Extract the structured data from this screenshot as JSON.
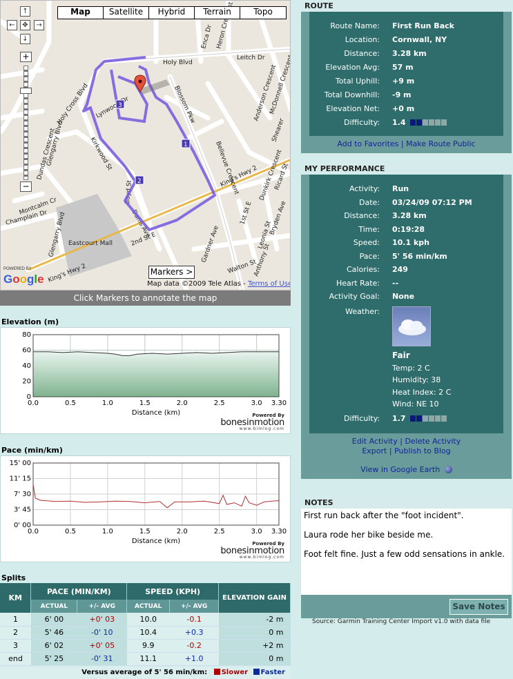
{
  "map": {
    "types": [
      "Map",
      "Satellite",
      "Hybrid",
      "Terrain",
      "Topo"
    ],
    "active_type": "Map",
    "markers_label": "Markers >",
    "logo_powered": "POWERED BY",
    "logo_text": "Google",
    "copyright": "Map data ©2009 Tele Atlas -",
    "terms": "Terms of Use",
    "caption": "Click Markers to annotate the map",
    "streets": [
      "Leitch Dr",
      "Holy Blvd",
      "Enca Dr",
      "Heron Crescent",
      "McDonnell Crescent",
      "Anderson Crescent",
      "Blossom Pkw",
      "Holy Cross Blvd",
      "Lynwood Dr",
      "Kirkwood St",
      "Glengarry Blvd",
      "Dundas Crescent",
      "Bellevue Crescent",
      "King's Hwy 2",
      "Dunkirk Crescent",
      "Ricard St",
      "Bryden Ave",
      "1st St E",
      "Leonia St",
      "Boyd St",
      "Danis Ave",
      "2nd St E",
      "Montcalm Cr",
      "Champlain Dr",
      "Gardner Ave",
      "Walton St",
      "Anthony St",
      "King's Hwy 2",
      "Eastcourt Mall",
      "Glengarry Blvd",
      "Shearer"
    ],
    "route_markers": [
      "1",
      "2",
      "3"
    ]
  },
  "elevation_chart": {
    "title": "Elevation (m)",
    "powered": "Powered By",
    "brand": "bonesinmotion",
    "brand_url": "www.bimlog.com"
  },
  "pace_chart": {
    "title": "Pace (min/km)",
    "powered": "Powered By",
    "brand": "bonesinmotion",
    "brand_url": "www.bimlog.com"
  },
  "chart_data": [
    {
      "type": "area",
      "title": "Elevation (m)",
      "xlabel": "Distance (km)",
      "ylabel": "",
      "xlim": [
        0,
        3.3
      ],
      "ylim": [
        0,
        80
      ],
      "x_ticks": [
        "0.0",
        "0.5",
        "1.0",
        "1.5",
        "2.0",
        "2.5",
        "3.0",
        "3.30"
      ],
      "y_ticks": [
        "0",
        "20",
        "40",
        "60",
        "80"
      ],
      "grid": true,
      "x": [
        0,
        0.2,
        0.4,
        0.6,
        0.8,
        1.0,
        1.1,
        1.2,
        1.3,
        1.4,
        1.6,
        1.8,
        2.0,
        2.2,
        2.4,
        2.6,
        2.8,
        3.0,
        3.2,
        3.3
      ],
      "values": [
        58,
        58,
        57,
        58,
        57,
        56,
        55,
        53,
        53,
        55,
        56,
        55,
        56,
        57,
        56,
        57,
        58,
        58,
        58,
        58
      ]
    },
    {
      "type": "line",
      "title": "Pace (min/km)",
      "xlabel": "Distance (km)",
      "ylabel": "",
      "xlim": [
        0,
        3.3
      ],
      "ylim": [
        0,
        15
      ],
      "x_ticks": [
        "0.0",
        "0.5",
        "1.0",
        "1.5",
        "2.0",
        "2.5",
        "3.0",
        "3.30"
      ],
      "y_ticks": [
        "0' 00",
        "3' 45",
        "7' 30",
        "11' 15",
        "15' 00"
      ],
      "grid": true,
      "x": [
        0,
        0.03,
        0.1,
        0.3,
        0.5,
        0.7,
        0.9,
        1.1,
        1.3,
        1.5,
        1.7,
        1.8,
        1.9,
        2.1,
        2.3,
        2.5,
        2.55,
        2.6,
        2.7,
        2.8,
        2.85,
        2.9,
        3.0,
        3.1,
        3.2,
        3.3
      ],
      "values": [
        9.8,
        6.5,
        6.0,
        5.7,
        5.8,
        5.5,
        5.6,
        5.8,
        5.7,
        5.4,
        5.7,
        4.2,
        5.6,
        5.6,
        5.8,
        5.2,
        7.2,
        5.0,
        5.4,
        4.6,
        7.0,
        5.4,
        4.8,
        5.6,
        5.8,
        5.9
      ]
    }
  ],
  "splits": {
    "title": "Splits",
    "headers": {
      "km": "KM",
      "pace": "PACE (MIN/KM)",
      "speed": "SPEED (KPH)",
      "elev": "ELEVATION GAIN",
      "actual": "ACTUAL",
      "avg": "+/- AVG"
    },
    "rows": [
      {
        "km": "1",
        "pace": "6' 00",
        "pace_avg": "+0' 03",
        "speed": "10.0",
        "speed_avg": "-0.1",
        "elev": "-2 m"
      },
      {
        "km": "2",
        "pace": "5' 46",
        "pace_avg": "-0' 10",
        "speed": "10.4",
        "speed_avg": "+0.3",
        "elev": "0 m"
      },
      {
        "km": "3",
        "pace": "6' 02",
        "pace_avg": "+0' 05",
        "speed": "9.9",
        "speed_avg": "-0.2",
        "elev": "+2 m"
      },
      {
        "km": "end",
        "pace": "5' 25",
        "pace_avg": "-0' 31",
        "speed": "11.1",
        "speed_avg": "+1.0",
        "elev": "0 m"
      }
    ],
    "legend": {
      "versus": "Versus average of 5' 56 min/km:",
      "slower": "Slower",
      "faster": "Faster"
    },
    "colors": {
      "slower": "#b00000",
      "faster": "#0b2a9c"
    }
  },
  "route": {
    "heading": "ROUTE",
    "fields": [
      {
        "label": "Route Name:",
        "value": "First Run Back"
      },
      {
        "label": "Location:",
        "value": "Cornwall, NY"
      },
      {
        "label": "Distance:",
        "value": "3.28 km"
      },
      {
        "label": "Elevation Avg:",
        "value": "57 m"
      },
      {
        "label": "Total Uphill:",
        "value": "+9 m"
      },
      {
        "label": "Total Downhill:",
        "value": "-9 m"
      },
      {
        "label": "Elevation Net:",
        "value": "+0 m"
      }
    ],
    "difficulty_label": "Difficulty:",
    "difficulty_value": "1.4",
    "difficulty_level": 2,
    "difficulty_max": 6,
    "add_favorites": "Add to Favorites",
    "separator": "|",
    "make_public": "Make Route Public"
  },
  "performance": {
    "heading": "MY PERFORMANCE",
    "fields": [
      {
        "label": "Activity:",
        "value": "Run"
      },
      {
        "label": "Date:",
        "value": "03/24/09   07:12 PM"
      },
      {
        "label": "Distance:",
        "value": "3.28 km"
      },
      {
        "label": "Time:",
        "value": "0:19:28"
      },
      {
        "label": "Speed:",
        "value": "10.1 kph"
      },
      {
        "label": "Pace:",
        "value": "5' 56 min/km"
      },
      {
        "label": "Calories:",
        "value": "249"
      },
      {
        "label": "Heart Rate:",
        "value": "--"
      },
      {
        "label": "Activity Goal:",
        "value": "None"
      }
    ],
    "weather_label": "Weather:",
    "weather": {
      "condition": "Fair",
      "temp": "Temp: 2 C",
      "humidity": "Humidity: 38",
      "heat_index": "Heat Index: 2 C",
      "wind": "Wind: NE 10"
    },
    "difficulty_label": "Difficulty:",
    "difficulty_value": "1.7",
    "difficulty_level": 2,
    "difficulty_max": 6,
    "edit": "Edit Activity",
    "delete": "Delete Activity",
    "export": "Export",
    "publish": "Publish to Blog",
    "separator": "|",
    "google_earth": "View in Google Earth"
  },
  "notes": {
    "heading": "NOTES",
    "lines": [
      "First run back after the \"foot incident\".",
      "Laura rode her bike beside me.",
      "Foot felt fine. Just a few odd sensations in ankle."
    ],
    "save_label": "Save Notes",
    "source": "Source: Garmin Training Center Import v1.0 with data file"
  }
}
